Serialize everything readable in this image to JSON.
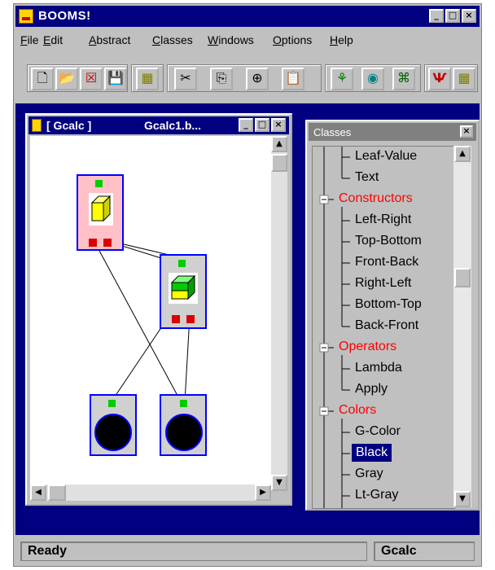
{
  "app": {
    "title": "BOOMS!"
  },
  "menu": [
    {
      "label": "File",
      "key": "F",
      "rest": "ile"
    },
    {
      "label": "Edit",
      "key": "E",
      "rest": "dit"
    },
    {
      "label": "Abstract",
      "key": "A",
      "rest": "bstract"
    },
    {
      "label": "Classes",
      "key": "C",
      "rest": "lasses"
    },
    {
      "label": "Windows",
      "key": "W",
      "rest": "indows"
    },
    {
      "label": "Options",
      "key": "O",
      "rest": "ptions"
    },
    {
      "label": "Help",
      "key": "H",
      "rest": "elp"
    }
  ],
  "toolbar_icons": [
    "new-file-icon",
    "open-folder-icon",
    "delete-icon",
    "save-icon",
    "calculator-icon",
    "cut-icon",
    "copy-icon",
    "copy-special-icon",
    "paste-icon",
    "tree-layout-icon",
    "globe-icon",
    "hierarchy-icon",
    "lambda-graph-icon",
    "calculator-2-icon"
  ],
  "gcalc_window": {
    "title": "[ Gcalc ]",
    "file": "Gcalc1.b..."
  },
  "classes_window": {
    "title": "Classes",
    "items": [
      {
        "label": "Leaf-Value",
        "type": "leaf"
      },
      {
        "label": "Text",
        "type": "leaf"
      },
      {
        "label": "Constructors",
        "type": "category"
      },
      {
        "label": "Left-Right",
        "type": "leaf"
      },
      {
        "label": "Top-Bottom",
        "type": "leaf"
      },
      {
        "label": "Front-Back",
        "type": "leaf"
      },
      {
        "label": "Right-Left",
        "type": "leaf"
      },
      {
        "label": "Bottom-Top",
        "type": "leaf"
      },
      {
        "label": "Back-Front",
        "type": "leaf"
      },
      {
        "label": "Operators",
        "type": "category"
      },
      {
        "label": "Lambda",
        "type": "leaf"
      },
      {
        "label": "Apply",
        "type": "leaf"
      },
      {
        "label": "Colors",
        "type": "category"
      },
      {
        "label": "G-Color",
        "type": "leaf"
      },
      {
        "label": "Black",
        "type": "leaf",
        "selected": true
      },
      {
        "label": "Gray",
        "type": "leaf"
      },
      {
        "label": "Lt-Gray",
        "type": "leaf"
      }
    ]
  },
  "status": {
    "left": "Ready",
    "right": "Gcalc"
  },
  "colors": {
    "title_bar": "#000080",
    "workspace": "#000080",
    "category_text": "#ff0000",
    "port": "#00cc00",
    "port_red": "#dd0000",
    "node_border": "#0000ff"
  }
}
